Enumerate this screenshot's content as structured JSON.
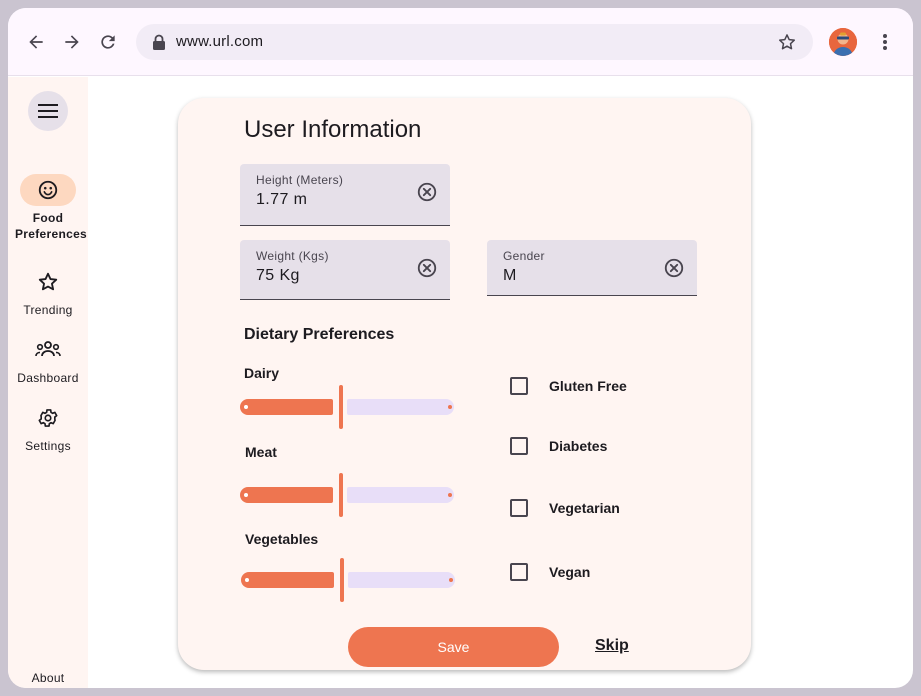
{
  "browser": {
    "url": "www.url.com",
    "icons": {
      "back": "arrow-back-icon",
      "forward": "arrow-forward-icon",
      "reload": "reload-icon",
      "lock": "lock-icon",
      "bookmark": "star-icon",
      "menu": "more-vert-icon"
    }
  },
  "rail": {
    "items": [
      {
        "label": "Food Preferences",
        "icon": "smiley-icon",
        "active": true
      },
      {
        "label": "Trending",
        "icon": "star-icon",
        "active": false
      },
      {
        "label": "Dashboard",
        "icon": "group-icon",
        "active": false
      },
      {
        "label": "Settings",
        "icon": "gear-icon",
        "active": false
      }
    ],
    "about": "About"
  },
  "form": {
    "title": "User Information",
    "height": {
      "label": "Height (Meters)",
      "value": "1.77 m"
    },
    "weight": {
      "label": "Weight (Kgs)",
      "value": "75 Kg"
    },
    "gender": {
      "label": "Gender",
      "value": "M"
    },
    "dietary_title": "Dietary Preferences",
    "sliders": [
      {
        "label": "Dairy",
        "level": 0.5
      },
      {
        "label": "Meat",
        "level": 0.5
      },
      {
        "label": "Vegetables",
        "level": 0.5
      }
    ],
    "checkboxes": [
      {
        "label": "Gluten Free",
        "checked": false
      },
      {
        "label": "Diabetes",
        "checked": false
      },
      {
        "label": "Vegetarian",
        "checked": false
      },
      {
        "label": "Vegan",
        "checked": false
      }
    ],
    "save_label": "Save",
    "skip_label": "Skip"
  },
  "colors": {
    "accent": "#ee7550",
    "rail_active": "#fdd8c0",
    "field_bg": "#e6e0e9",
    "track_inactive": "#e8def8",
    "card_bg": "#fff5f2"
  }
}
